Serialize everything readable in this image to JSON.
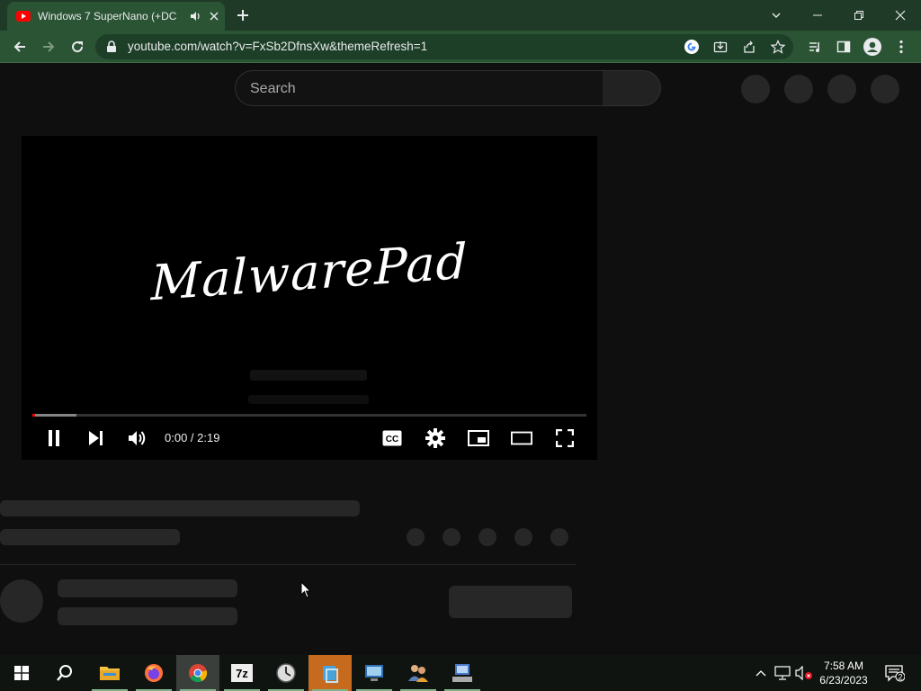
{
  "browser": {
    "tab_title": "Windows 7 SuperNano (+DC",
    "url": "youtube.com/watch?v=FxSb2DfnsXw&themeRefresh=1",
    "colors": {
      "frame": "#1f3b27",
      "toolbar": "#2a5434"
    }
  },
  "youtube": {
    "search_placeholder": "Search",
    "player": {
      "video_title_text": "MalwarePad",
      "time": "0:00 / 2:19",
      "progress_played": 0.0,
      "progress_loaded": 0.08
    }
  },
  "taskbar": {
    "clock_time": "7:58 AM",
    "clock_date": "6/23/2023",
    "notification_count": "2",
    "apps": [
      "start-icon",
      "search-icon",
      "file-explorer-icon",
      "firefox-icon",
      "chrome-icon",
      "7zip-icon",
      "clock-app-icon",
      "app-icon",
      "control-panel-icon",
      "users-icon",
      "computer-icon"
    ]
  }
}
